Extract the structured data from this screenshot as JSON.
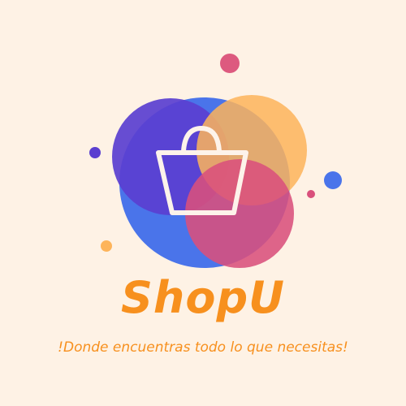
{
  "brand": {
    "name": "ShopU",
    "tagline": "!Donde encuentras todo lo que necesitas!"
  },
  "colors": {
    "background": "#fef2e5",
    "blue": "#4a74ea",
    "purple": "#5a3fd0",
    "orange": "#fdb45a",
    "pink": "#d9507c",
    "text": "#f7901e"
  }
}
